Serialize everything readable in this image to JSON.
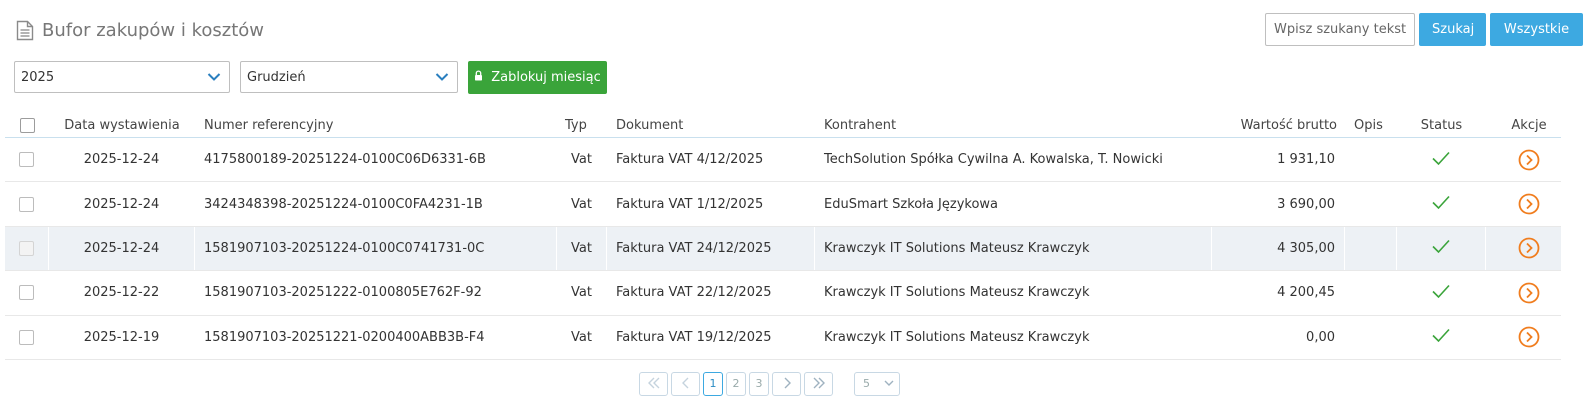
{
  "header": {
    "title": "Bufor zakupów i kosztów",
    "search_placeholder": "Wpisz szukany tekst",
    "search_button": "Szukaj",
    "all_button": "Wszystkie"
  },
  "filters": {
    "year": "2025",
    "month": "Grudzień",
    "lock_button": "Zablokuj miesiąc"
  },
  "table": {
    "columns": [
      "Data wystawienia",
      "Numer referencyjny",
      "Typ",
      "Dokument",
      "Kontrahent",
      "Wartość brutto",
      "Opis",
      "Status",
      "Akcje"
    ],
    "rows": [
      {
        "date": "2025-12-24",
        "ref": "4175800189-20251224-0100C06D6331-6B",
        "type": "Vat",
        "doc": "Faktura VAT 4/12/2025",
        "contractor": "TechSolution Spółka Cywilna A. Kowalska, T. Nowicki",
        "value": "1 931,10",
        "desc": ""
      },
      {
        "date": "2025-12-24",
        "ref": "3424348398-20251224-0100C0FA4231-1B",
        "type": "Vat",
        "doc": "Faktura VAT 1/12/2025",
        "contractor": "EduSmart Szkoła Językowa",
        "value": "3 690,00",
        "desc": ""
      },
      {
        "date": "2025-12-24",
        "ref": "1581907103-20251224-0100C0741731-0C",
        "type": "Vat",
        "doc": "Faktura VAT 24/12/2025",
        "contractor": "Krawczyk IT Solutions Mateusz Krawczyk",
        "value": "4 305,00",
        "desc": ""
      },
      {
        "date": "2025-12-22",
        "ref": "1581907103-20251222-0100805E762F-92",
        "type": "Vat",
        "doc": "Faktura VAT 22/12/2025",
        "contractor": "Krawczyk IT Solutions Mateusz Krawczyk",
        "value": "4 200,45",
        "desc": ""
      },
      {
        "date": "2025-12-19",
        "ref": "1581907103-20251221-0200400ABB3B-F4",
        "type": "Vat",
        "doc": "Faktura VAT 19/12/2025",
        "contractor": "Krawczyk IT Solutions Mateusz Krawczyk",
        "value": "0,00",
        "desc": ""
      }
    ]
  },
  "pagination": {
    "pages": [
      "1",
      "2",
      "3"
    ],
    "current": "1",
    "page_size": "5"
  },
  "colors": {
    "primary_blue": "#3da9e1",
    "lock_green": "#3aa43a",
    "status_green": "#3aa43a",
    "action_orange": "#f07d1e"
  },
  "icons": [
    "document-icon",
    "chevron-down-icon",
    "lock-icon",
    "check-icon",
    "arrow-circle-right-icon",
    "first-page-icon",
    "prev-page-icon",
    "next-page-icon",
    "last-page-icon"
  ]
}
